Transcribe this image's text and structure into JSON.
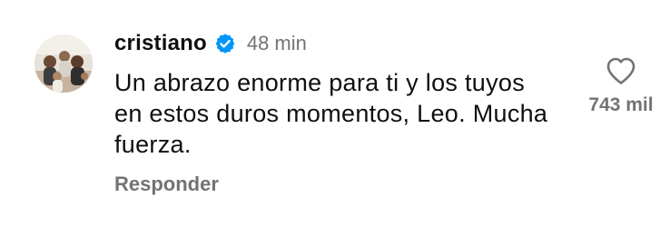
{
  "comment": {
    "author": "cristiano",
    "verified": true,
    "timestamp": "48 min",
    "text": "Un abrazo enorme para ti y los tuyos en estos duros momentos, Leo. Mucha fuerza.",
    "reply_label": "Responder",
    "like_count": "743 mil",
    "liked": false
  },
  "colors": {
    "verified_badge": "#0095f6",
    "secondary_text": "#737373",
    "primary_text": "#0f0f0f"
  },
  "icons": {
    "verified": "verified-badge-icon",
    "like": "heart-outline-icon",
    "avatar": "profile-photo"
  }
}
